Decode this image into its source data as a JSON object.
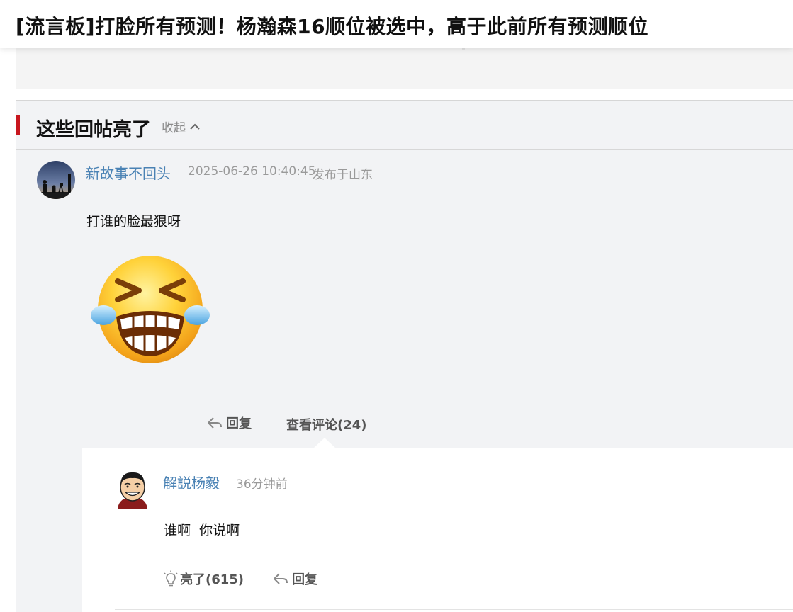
{
  "thread": {
    "title": "[流言板]打脸所有预测！杨瀚森16顺位被选中，高于此前所有预测顺位"
  },
  "highlights": {
    "section_title": "这些回帖亮了",
    "collapse_label": "收起"
  },
  "post": {
    "author": "新故事不回头",
    "time": "2025-06-26 10:40:45",
    "location": "发布于山东",
    "text": "打谁的脸最狠呀",
    "emoji_icon": "laughing-tears-emoji",
    "actions": {
      "reply_label": "回复",
      "view_comments_label": "查看评论(24)"
    }
  },
  "comment": {
    "author": "解説杨毅",
    "time": "36分钟前",
    "text": "谁啊  你说啊",
    "actions": {
      "light_label": "亮了(615)",
      "reply_label": "回复"
    }
  },
  "colors": {
    "accent_red": "#c8161e",
    "username_blue": "#4a82b4",
    "muted_gray": "#9a9a9a",
    "panel_bg": "#f2f3f5"
  }
}
